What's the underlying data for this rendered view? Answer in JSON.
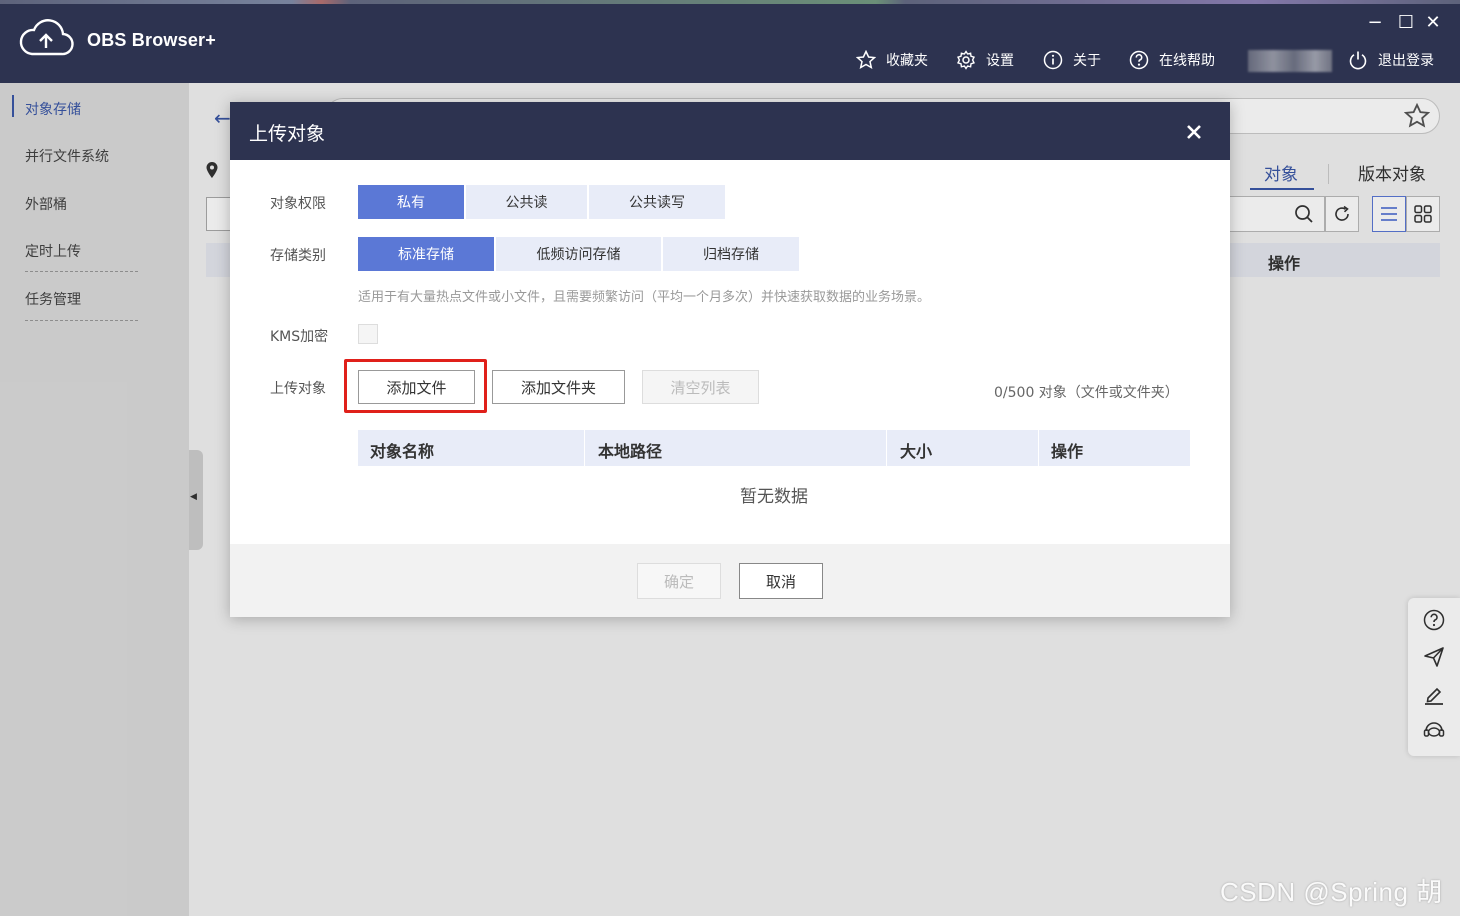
{
  "app": {
    "title": "OBS Browser+",
    "window_controls": {
      "minimize": "−",
      "maximize": "☐",
      "close": "✕"
    }
  },
  "header": {
    "nav": [
      {
        "label": "收藏夹",
        "icon": "star-icon"
      },
      {
        "label": "设置",
        "icon": "gear-icon"
      },
      {
        "label": "关于",
        "icon": "info-icon"
      },
      {
        "label": "在线帮助",
        "icon": "help-icon"
      },
      {
        "label": "退出登录",
        "icon": "power-icon"
      }
    ]
  },
  "sidebar": {
    "items": [
      {
        "label": "对象存储",
        "active": true
      },
      {
        "label": "并行文件系统",
        "active": false
      },
      {
        "label": "外部桶",
        "active": false
      },
      {
        "label": "定时上传",
        "active": false
      },
      {
        "label": "任务管理",
        "active": false
      }
    ]
  },
  "background": {
    "tabs": [
      {
        "label": "对象",
        "active": true
      },
      {
        "label": "版本对象",
        "active": false
      }
    ],
    "table_op_header": "操作"
  },
  "modal": {
    "title": "上传对象",
    "permission": {
      "label": "对象权限",
      "options": [
        "私有",
        "公共读",
        "公共读写"
      ],
      "selected": "私有"
    },
    "storage_class": {
      "label": "存储类别",
      "options": [
        "标准存储",
        "低频访问存储",
        "归档存储"
      ],
      "selected": "标准存储",
      "hint": "适用于有大量热点文件或小文件，且需要频繁访问（平均一个月多次）并快速获取数据的业务场景。"
    },
    "kms": {
      "label": "KMS加密",
      "checked": false
    },
    "upload": {
      "label": "上传对象",
      "add_file": "添加文件",
      "add_folder": "添加文件夹",
      "clear_list": "清空列表",
      "count": "0/500 对象（文件或文件夹）"
    },
    "table": {
      "columns": [
        "对象名称",
        "本地路径",
        "大小",
        "操作"
      ],
      "empty_text": "暂无数据"
    },
    "footer": {
      "confirm": "确定",
      "cancel": "取消"
    },
    "highlight_color": "#e0201a"
  },
  "watermark": "CSDN @Spring  胡",
  "colors": {
    "header_bg": "#2d3350",
    "accent": "#5b78d6",
    "link": "#3a57a8"
  }
}
